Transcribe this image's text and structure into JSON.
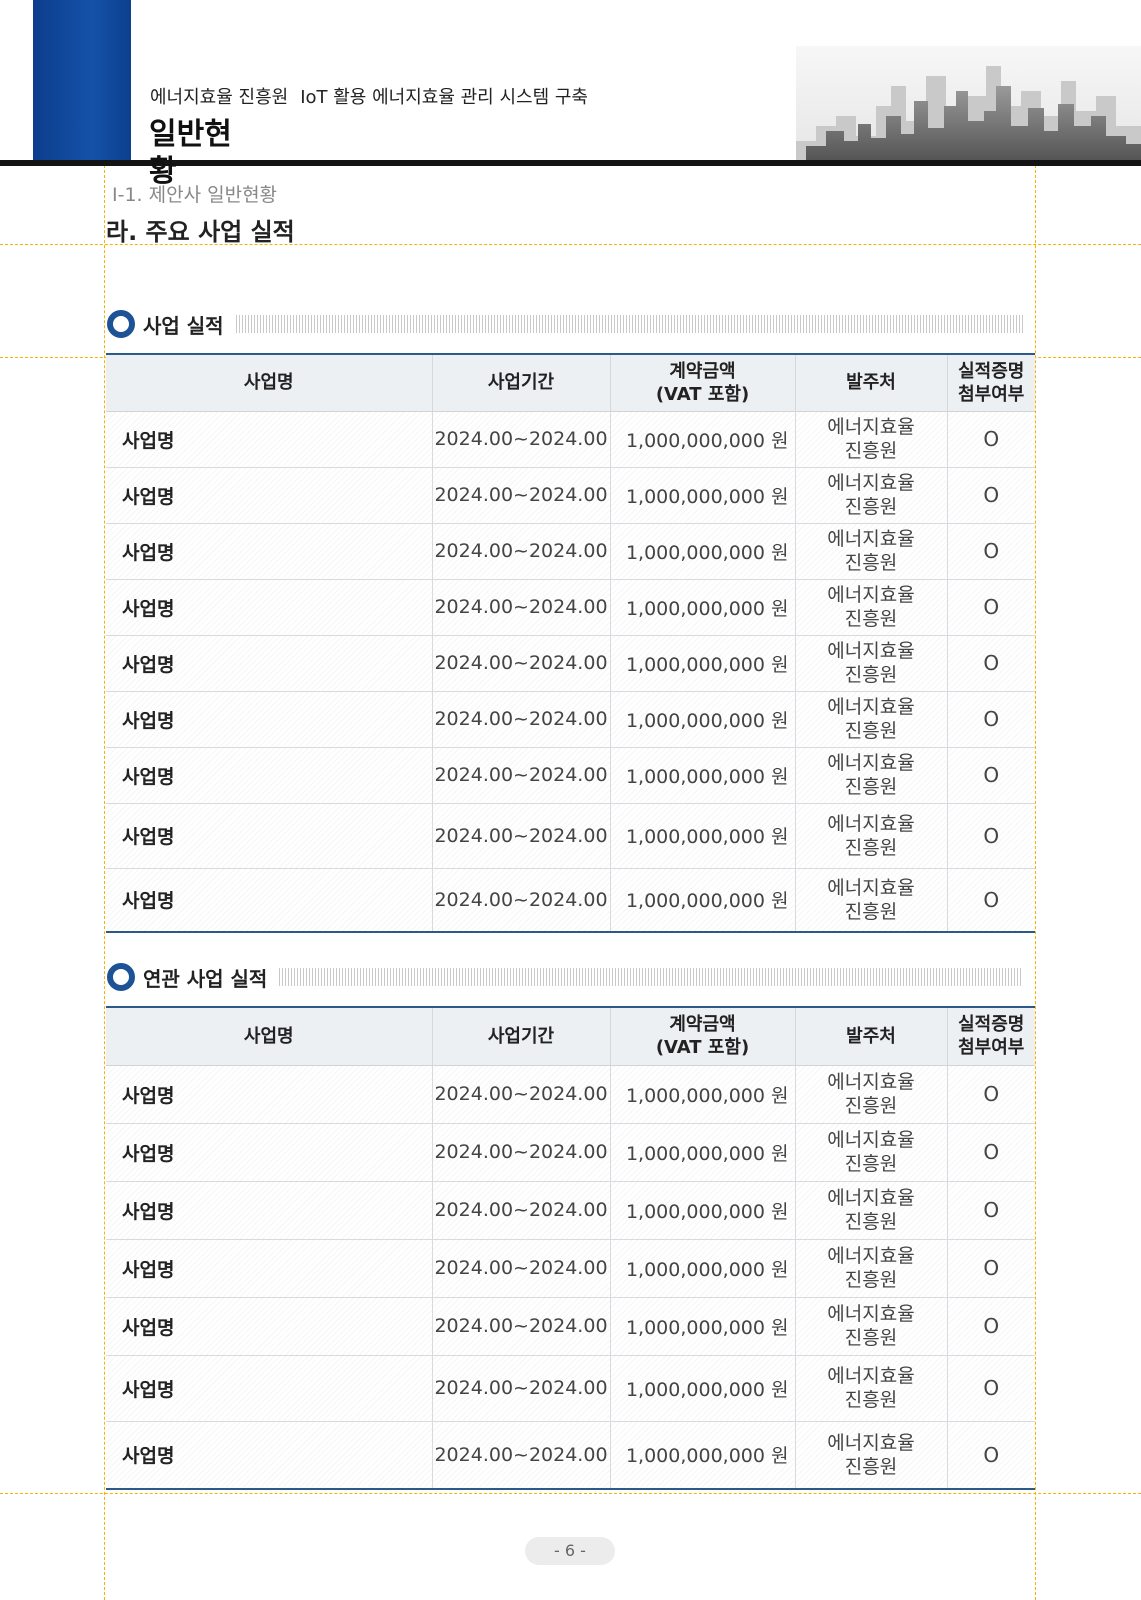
{
  "header": {
    "org": "에너지효율 진흥원",
    "project": "IoT 활용 에너지효율 관리 시스템 구축",
    "title": "일반현황"
  },
  "breadcrumb": "Ⅰ-1. 제안사 일반현황",
  "section_title": "라. 주요 사업 실적",
  "columns": [
    "사업명",
    "사업기간",
    "계약금액\n(VAT 포함)",
    "발주처",
    "실적증명\n첨부여부"
  ],
  "table1": {
    "title": "사업 실적",
    "rows": [
      {
        "name": "사업명",
        "period": "2024.00~2024.00",
        "amount": "1,000,000,000 원",
        "client": "에너지효율\n진흥원",
        "attached": "O"
      },
      {
        "name": "사업명",
        "period": "2024.00~2024.00",
        "amount": "1,000,000,000 원",
        "client": "에너지효율\n진흥원",
        "attached": "O"
      },
      {
        "name": "사업명",
        "period": "2024.00~2024.00",
        "amount": "1,000,000,000 원",
        "client": "에너지효율\n진흥원",
        "attached": "O"
      },
      {
        "name": "사업명",
        "period": "2024.00~2024.00",
        "amount": "1,000,000,000 원",
        "client": "에너지효율\n진흥원",
        "attached": "O"
      },
      {
        "name": "사업명",
        "period": "2024.00~2024.00",
        "amount": "1,000,000,000 원",
        "client": "에너지효율\n진흥원",
        "attached": "O"
      },
      {
        "name": "사업명",
        "period": "2024.00~2024.00",
        "amount": "1,000,000,000 원",
        "client": "에너지효율\n진흥원",
        "attached": "O"
      },
      {
        "name": "사업명",
        "period": "2024.00~2024.00",
        "amount": "1,000,000,000 원",
        "client": "에너지효율\n진흥원",
        "attached": "O"
      },
      {
        "name": "사업명",
        "period": "2024.00~2024.00",
        "amount": "1,000,000,000 원",
        "client": "에너지효율\n진흥원",
        "attached": "O"
      },
      {
        "name": "사업명",
        "period": "2024.00~2024.00",
        "amount": "1,000,000,000 원",
        "client": "에너지효율\n진흥원",
        "attached": "O"
      }
    ]
  },
  "table2": {
    "title": "연관 사업 실적",
    "rows": [
      {
        "name": "사업명",
        "period": "2024.00~2024.00",
        "amount": "1,000,000,000 원",
        "client": "에너지효율\n진흥원",
        "attached": "O"
      },
      {
        "name": "사업명",
        "period": "2024.00~2024.00",
        "amount": "1,000,000,000 원",
        "client": "에너지효율\n진흥원",
        "attached": "O"
      },
      {
        "name": "사업명",
        "period": "2024.00~2024.00",
        "amount": "1,000,000,000 원",
        "client": "에너지효율\n진흥원",
        "attached": "O"
      },
      {
        "name": "사업명",
        "period": "2024.00~2024.00",
        "amount": "1,000,000,000 원",
        "client": "에너지효율\n진흥원",
        "attached": "O"
      },
      {
        "name": "사업명",
        "period": "2024.00~2024.00",
        "amount": "1,000,000,000 원",
        "client": "에너지효율\n진흥원",
        "attached": "O"
      },
      {
        "name": "사업명",
        "period": "2024.00~2024.00",
        "amount": "1,000,000,000 원",
        "client": "에너지효율\n진흥원",
        "attached": "O"
      },
      {
        "name": "사업명",
        "period": "2024.00~2024.00",
        "amount": "1,000,000,000 원",
        "client": "에너지효율\n진흥원",
        "attached": "O"
      }
    ]
  },
  "page_number": "- 6 -",
  "colors": {
    "brand_blue": "#1452a8",
    "table_rule": "#2b5a8a",
    "guide": "#f4b400"
  }
}
